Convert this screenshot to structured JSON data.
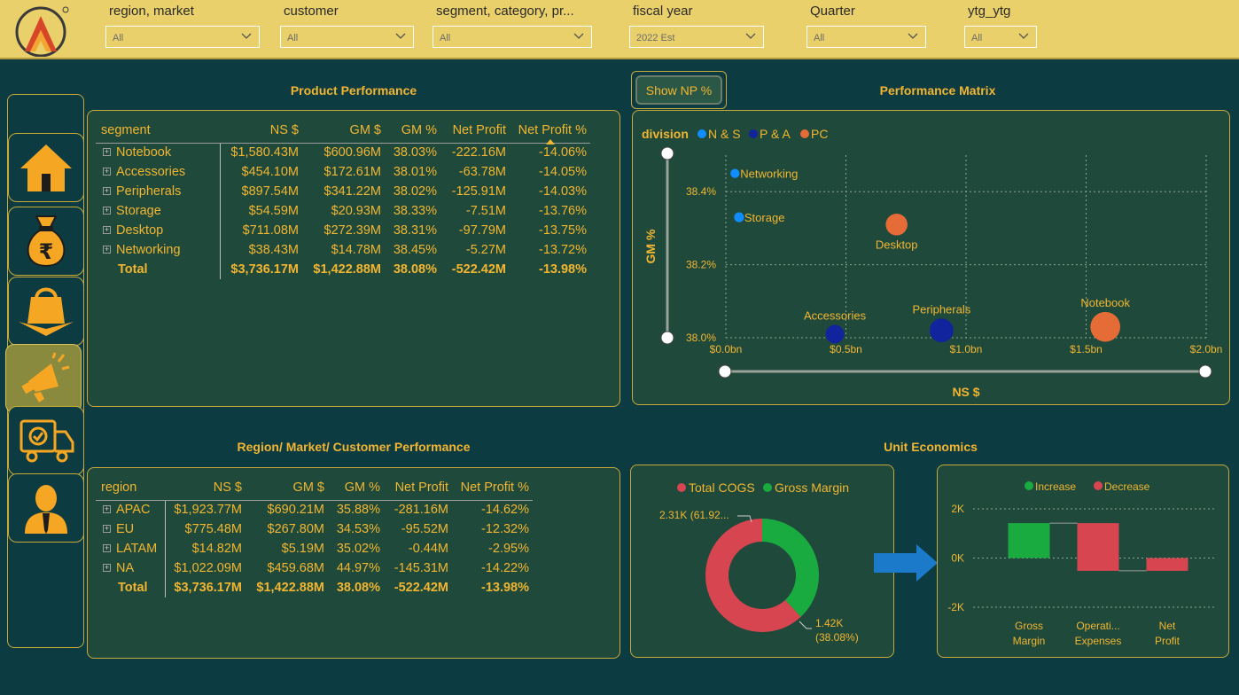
{
  "filters": [
    {
      "label": "region, market",
      "value": "All"
    },
    {
      "label": "customer",
      "value": "All"
    },
    {
      "label": "segment, category, pr...",
      "value": "All"
    },
    {
      "label": "fiscal year",
      "value": "2022 Est"
    },
    {
      "label": "Quarter",
      "value": "All"
    },
    {
      "label": "ytg_ytg",
      "value": "All"
    }
  ],
  "nav": [
    "home-icon",
    "money-bag-rupee-icon",
    "shopping-bag-icon",
    "megaphone-icon",
    "delivery-truck-icon",
    "user-icon"
  ],
  "product_performance": {
    "title": "Product Performance",
    "headers": [
      "segment",
      "NS $",
      "GM $",
      "GM %",
      "Net Profit",
      "Net Profit %"
    ],
    "rows": [
      [
        "Notebook",
        "$1,580.43M",
        "$600.96M",
        "38.03%",
        "-222.16M",
        "-14.06%"
      ],
      [
        "Accessories",
        "$454.10M",
        "$172.61M",
        "38.01%",
        "-63.78M",
        "-14.05%"
      ],
      [
        "Peripherals",
        "$897.54M",
        "$341.22M",
        "38.02%",
        "-125.91M",
        "-14.03%"
      ],
      [
        "Storage",
        "$54.59M",
        "$20.93M",
        "38.33%",
        "-7.51M",
        "-13.76%"
      ],
      [
        "Desktop",
        "$711.08M",
        "$272.39M",
        "38.31%",
        "-97.79M",
        "-13.75%"
      ],
      [
        "Networking",
        "$38.43M",
        "$14.78M",
        "38.45%",
        "-5.27M",
        "-13.72%"
      ]
    ],
    "total": [
      "Total",
      "$3,736.17M",
      "$1,422.88M",
      "38.08%",
      "-522.42M",
      "-13.98%"
    ]
  },
  "region_performance": {
    "title": "Region/ Market/ Customer Performance",
    "headers": [
      "region",
      "NS $",
      "GM $",
      "GM %",
      "Net Profit",
      "Net Profit %"
    ],
    "rows": [
      [
        "APAC",
        "$1,923.77M",
        "$690.21M",
        "35.88%",
        "-281.16M",
        "-14.62%"
      ],
      [
        "EU",
        "$775.48M",
        "$267.80M",
        "34.53%",
        "-95.52M",
        "-12.32%"
      ],
      [
        "LATAM",
        "$14.82M",
        "$5.19M",
        "35.02%",
        "-0.44M",
        "-2.95%"
      ],
      [
        "NA",
        "$1,022.09M",
        "$459.68M",
        "44.97%",
        "-145.31M",
        "-14.22%"
      ]
    ],
    "total": [
      "Total",
      "$3,736.17M",
      "$1,422.88M",
      "38.08%",
      "-522.42M",
      "-13.98%"
    ]
  },
  "show_np_label": "Show NP %",
  "performance_matrix": {
    "title": "Performance Matrix",
    "legend_title": "division",
    "xlabel": "NS $",
    "ylabel": "GM %",
    "x_ticks": [
      "$0.0bn",
      "$0.5bn",
      "$1.0bn",
      "$1.5bn",
      "$2.0bn"
    ],
    "y_ticks": [
      "38.4%",
      "38.2%",
      "38.0%"
    ]
  },
  "unit_economics": {
    "title": "Unit Economics",
    "donut_labels": [
      "2.31K (61.92...",
      "1.42K",
      "(38.08%)"
    ],
    "waterfall_ticks": [
      "2K",
      "0K",
      "-2K"
    ],
    "waterfall_cats": [
      [
        "Gross",
        "Margin"
      ],
      [
        "Operati...",
        "Expenses"
      ],
      [
        "Net",
        "Profit"
      ]
    ]
  },
  "chart_data": [
    {
      "type": "scatter",
      "title": "Performance Matrix",
      "xlabel": "NS $",
      "ylabel": "GM %",
      "xlim": [
        0,
        2.0
      ],
      "ylim": [
        38.0,
        38.5
      ],
      "legend": "top-left",
      "series": [
        {
          "name": "N & S",
          "color": "#118dff",
          "points": [
            {
              "label": "Networking",
              "x": 0.038,
              "y": 38.45,
              "size": 0.038
            },
            {
              "label": "Storage",
              "x": 0.055,
              "y": 38.33,
              "size": 0.055
            }
          ]
        },
        {
          "name": "P & A",
          "color": "#12239e",
          "points": [
            {
              "label": "Accessories",
              "x": 0.454,
              "y": 38.01,
              "size": 0.454
            },
            {
              "label": "Peripherals",
              "x": 0.898,
              "y": 38.02,
              "size": 0.898
            }
          ]
        },
        {
          "name": "PC",
          "color": "#e66c37",
          "points": [
            {
              "label": "Desktop",
              "x": 0.711,
              "y": 38.31,
              "size": 0.711
            },
            {
              "label": "Notebook",
              "x": 1.58,
              "y": 38.03,
              "size": 1.58
            }
          ]
        }
      ]
    },
    {
      "type": "pie",
      "donut": true,
      "legend": "top",
      "categories": [
        "Total COGS",
        "Gross Margin"
      ],
      "values": [
        2.31,
        1.42
      ],
      "percent": [
        61.92,
        38.08
      ],
      "colors": [
        "#d64550",
        "#1aab40"
      ]
    },
    {
      "type": "bar",
      "waterfall": true,
      "legend": "top",
      "legend_entries": [
        {
          "name": "Increase",
          "color": "#1aab40"
        },
        {
          "name": "Decrease",
          "color": "#d64550"
        }
      ],
      "categories": [
        "Gross Margin",
        "Operating Expenses",
        "Net Profit"
      ],
      "values": [
        1.42,
        -1.94,
        -0.52
      ],
      "ylim": [
        -2,
        2
      ]
    }
  ]
}
